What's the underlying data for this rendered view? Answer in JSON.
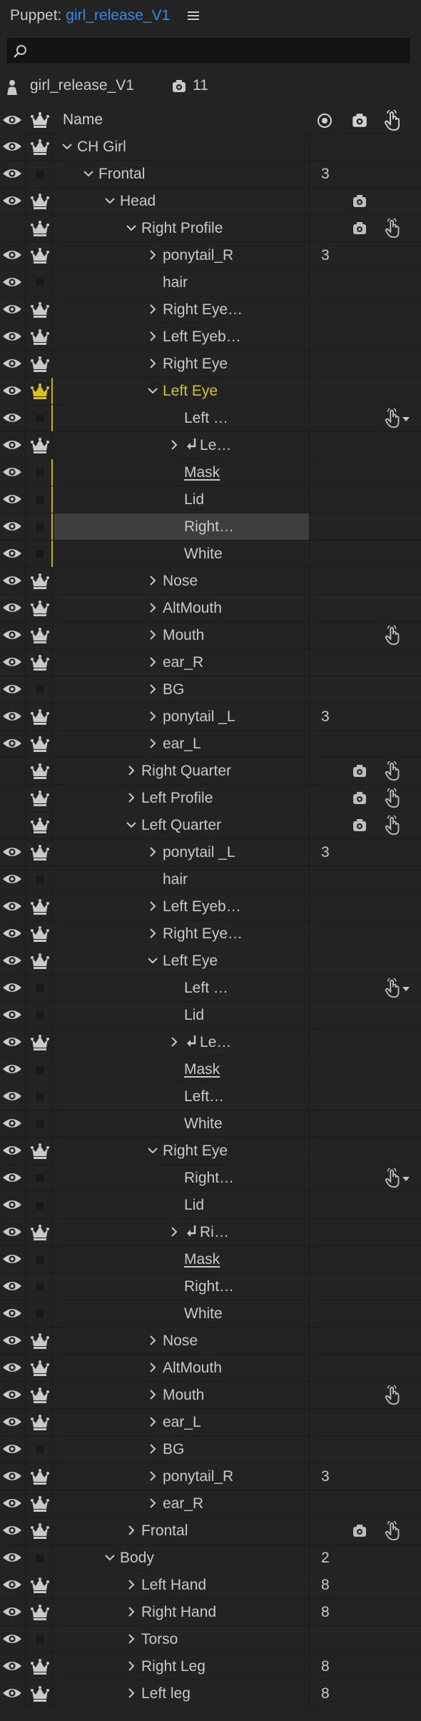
{
  "panel": {
    "title_prefix": "Puppet:",
    "doc_name": "girl_release_V1",
    "menu_icon": "hamburger-menu-icon",
    "search_icon": "search-icon",
    "puppet_name": "girl_release_V1",
    "camera_count": "11"
  },
  "columns": {
    "visibility_icon": "eye-icon",
    "independent_icon": "crown-icon",
    "name": "Name",
    "origin_icon": "origin-target-icon",
    "camera_icon": "camera-icon",
    "trigger_icon": "hand-trigger-icon"
  },
  "colors": {
    "accent": "#2d8ceb",
    "selected_layer": "#d7c224",
    "background": "#232323"
  },
  "rows": [
    {
      "name": "CH Girl",
      "depth": 0,
      "expand": "open",
      "eye": true,
      "crown": true,
      "col3": "",
      "cam": false,
      "trigger": ""
    },
    {
      "name": "Frontal",
      "depth": 1,
      "expand": "open",
      "eye": true,
      "crown": false,
      "col3": "3",
      "cam": false,
      "trigger": ""
    },
    {
      "name": "Head",
      "depth": 2,
      "expand": "open",
      "eye": true,
      "crown": true,
      "col3": "",
      "cam": true,
      "trigger": ""
    },
    {
      "name": "Right Profile",
      "depth": 3,
      "expand": "open",
      "eye": false,
      "crown": true,
      "col3": "",
      "cam": true,
      "trigger": "hand"
    },
    {
      "name": "ponytail_R",
      "depth": 4,
      "expand": "closed",
      "eye": true,
      "crown": true,
      "col3": "3",
      "cam": false,
      "trigger": ""
    },
    {
      "name": "hair",
      "depth": 4,
      "expand": "none",
      "eye": true,
      "crown": false,
      "col3": "",
      "cam": false,
      "trigger": ""
    },
    {
      "name": "Right Eye…",
      "depth": 4,
      "expand": "closed",
      "eye": true,
      "crown": true,
      "col3": "",
      "cam": false,
      "trigger": ""
    },
    {
      "name": "Left Eyeb…",
      "depth": 4,
      "expand": "closed",
      "eye": true,
      "crown": true,
      "col3": "",
      "cam": false,
      "trigger": ""
    },
    {
      "name": "Right Eye",
      "depth": 4,
      "expand": "closed",
      "eye": true,
      "crown": true,
      "col3": "",
      "cam": false,
      "trigger": ""
    },
    {
      "name": "Left Eye",
      "depth": 4,
      "expand": "open",
      "eye": true,
      "crown": true,
      "col3": "",
      "cam": false,
      "trigger": "",
      "selected": true
    },
    {
      "name": "Left …",
      "depth": 5,
      "expand": "none",
      "eye": true,
      "crown": false,
      "col3": "",
      "cam": false,
      "trigger": "hand-menu",
      "yellow": true
    },
    {
      "name": "Le…",
      "depth": 5,
      "expand": "closed",
      "arrow": true,
      "eye": true,
      "crown": true,
      "col3": "",
      "cam": false,
      "trigger": ""
    },
    {
      "name": "Mask",
      "depth": 5,
      "expand": "none",
      "underline": true,
      "eye": true,
      "crown": false,
      "col3": "",
      "cam": false,
      "trigger": "",
      "yellow": true
    },
    {
      "name": "Lid",
      "depth": 5,
      "expand": "none",
      "eye": true,
      "crown": false,
      "col3": "",
      "cam": false,
      "trigger": "",
      "yellow": true
    },
    {
      "name": "Right…",
      "depth": 5,
      "expand": "none",
      "eye": true,
      "crown": false,
      "col3": "",
      "cam": false,
      "trigger": "",
      "highlight": true,
      "yellow": true
    },
    {
      "name": "White",
      "depth": 5,
      "expand": "none",
      "eye": true,
      "crown": false,
      "col3": "",
      "cam": false,
      "trigger": "",
      "yellow": true
    },
    {
      "name": "Nose",
      "depth": 4,
      "expand": "closed",
      "eye": true,
      "crown": true,
      "col3": "",
      "cam": false,
      "trigger": ""
    },
    {
      "name": "AltMouth",
      "depth": 4,
      "expand": "closed",
      "eye": true,
      "crown": true,
      "col3": "",
      "cam": false,
      "trigger": ""
    },
    {
      "name": "Mouth",
      "depth": 4,
      "expand": "closed",
      "eye": true,
      "crown": true,
      "col3": "",
      "cam": false,
      "trigger": "hand"
    },
    {
      "name": "ear_R",
      "depth": 4,
      "expand": "closed",
      "eye": true,
      "crown": true,
      "col3": "",
      "cam": false,
      "trigger": ""
    },
    {
      "name": "BG",
      "depth": 4,
      "expand": "closed",
      "eye": true,
      "crown": false,
      "col3": "",
      "cam": false,
      "trigger": ""
    },
    {
      "name": "ponytail _L",
      "depth": 4,
      "expand": "closed",
      "eye": true,
      "crown": true,
      "col3": "3",
      "cam": false,
      "trigger": ""
    },
    {
      "name": "ear_L",
      "depth": 4,
      "expand": "closed",
      "eye": true,
      "crown": true,
      "col3": "",
      "cam": false,
      "trigger": ""
    },
    {
      "name": "Right Quarter",
      "depth": 3,
      "expand": "closed",
      "eye": false,
      "crown": true,
      "col3": "",
      "cam": true,
      "trigger": "hand"
    },
    {
      "name": "Left Profile",
      "depth": 3,
      "expand": "closed",
      "eye": false,
      "crown": true,
      "col3": "",
      "cam": true,
      "trigger": "hand"
    },
    {
      "name": "Left Quarter",
      "depth": 3,
      "expand": "open",
      "eye": false,
      "crown": true,
      "col3": "",
      "cam": true,
      "trigger": "hand"
    },
    {
      "name": "ponytail _L",
      "depth": 4,
      "expand": "closed",
      "eye": true,
      "crown": true,
      "col3": "3",
      "cam": false,
      "trigger": ""
    },
    {
      "name": "hair",
      "depth": 4,
      "expand": "none",
      "eye": true,
      "crown": false,
      "col3": "",
      "cam": false,
      "trigger": ""
    },
    {
      "name": "Left Eyeb…",
      "depth": 4,
      "expand": "closed",
      "eye": true,
      "crown": true,
      "col3": "",
      "cam": false,
      "trigger": ""
    },
    {
      "name": "Right Eye…",
      "depth": 4,
      "expand": "closed",
      "eye": true,
      "crown": true,
      "col3": "",
      "cam": false,
      "trigger": ""
    },
    {
      "name": "Left Eye",
      "depth": 4,
      "expand": "open",
      "eye": true,
      "crown": true,
      "col3": "",
      "cam": false,
      "trigger": ""
    },
    {
      "name": "Left …",
      "depth": 5,
      "expand": "none",
      "eye": true,
      "crown": false,
      "col3": "",
      "cam": false,
      "trigger": "hand-menu"
    },
    {
      "name": "Lid",
      "depth": 5,
      "expand": "none",
      "eye": true,
      "crown": false,
      "col3": "",
      "cam": false,
      "trigger": ""
    },
    {
      "name": "Le…",
      "depth": 5,
      "expand": "closed",
      "arrow": true,
      "eye": true,
      "crown": true,
      "col3": "",
      "cam": false,
      "trigger": ""
    },
    {
      "name": "Mask",
      "depth": 5,
      "expand": "none",
      "underline": true,
      "eye": true,
      "crown": false,
      "col3": "",
      "cam": false,
      "trigger": ""
    },
    {
      "name": "Left…",
      "depth": 5,
      "expand": "none",
      "eye": true,
      "crown": false,
      "col3": "",
      "cam": false,
      "trigger": ""
    },
    {
      "name": "White",
      "depth": 5,
      "expand": "none",
      "eye": true,
      "crown": false,
      "col3": "",
      "cam": false,
      "trigger": ""
    },
    {
      "name": "Right Eye",
      "depth": 4,
      "expand": "open",
      "eye": true,
      "crown": true,
      "col3": "",
      "cam": false,
      "trigger": ""
    },
    {
      "name": "Right…",
      "depth": 5,
      "expand": "none",
      "eye": true,
      "crown": false,
      "col3": "",
      "cam": false,
      "trigger": "hand-menu"
    },
    {
      "name": "Lid",
      "depth": 5,
      "expand": "none",
      "eye": true,
      "crown": false,
      "col3": "",
      "cam": false,
      "trigger": ""
    },
    {
      "name": "Ri…",
      "depth": 5,
      "expand": "closed",
      "arrow": true,
      "eye": true,
      "crown": true,
      "col3": "",
      "cam": false,
      "trigger": ""
    },
    {
      "name": "Mask",
      "depth": 5,
      "expand": "none",
      "underline": true,
      "eye": true,
      "crown": false,
      "col3": "",
      "cam": false,
      "trigger": ""
    },
    {
      "name": "Right…",
      "depth": 5,
      "expand": "none",
      "eye": true,
      "crown": false,
      "col3": "",
      "cam": false,
      "trigger": ""
    },
    {
      "name": "White",
      "depth": 5,
      "expand": "none",
      "eye": true,
      "crown": false,
      "col3": "",
      "cam": false,
      "trigger": ""
    },
    {
      "name": "Nose",
      "depth": 4,
      "expand": "closed",
      "eye": true,
      "crown": true,
      "col3": "",
      "cam": false,
      "trigger": ""
    },
    {
      "name": "AltMouth",
      "depth": 4,
      "expand": "closed",
      "eye": true,
      "crown": true,
      "col3": "",
      "cam": false,
      "trigger": ""
    },
    {
      "name": "Mouth",
      "depth": 4,
      "expand": "closed",
      "eye": true,
      "crown": true,
      "col3": "",
      "cam": false,
      "trigger": "hand"
    },
    {
      "name": "ear_L",
      "depth": 4,
      "expand": "closed",
      "eye": true,
      "crown": true,
      "col3": "",
      "cam": false,
      "trigger": ""
    },
    {
      "name": "BG",
      "depth": 4,
      "expand": "closed",
      "eye": true,
      "crown": false,
      "col3": "",
      "cam": false,
      "trigger": ""
    },
    {
      "name": "ponytail_R",
      "depth": 4,
      "expand": "closed",
      "eye": true,
      "crown": true,
      "col3": "3",
      "cam": false,
      "trigger": ""
    },
    {
      "name": "ear_R",
      "depth": 4,
      "expand": "closed",
      "eye": true,
      "crown": true,
      "col3": "",
      "cam": false,
      "trigger": ""
    },
    {
      "name": "Frontal",
      "depth": 3,
      "expand": "closed",
      "eye": true,
      "crown": true,
      "col3": "",
      "cam": true,
      "trigger": "hand"
    },
    {
      "name": "Body",
      "depth": 2,
      "expand": "open",
      "eye": true,
      "crown": false,
      "col3": "2",
      "cam": false,
      "trigger": ""
    },
    {
      "name": "Left Hand",
      "depth": 3,
      "expand": "closed",
      "eye": true,
      "crown": true,
      "col3": "8",
      "cam": false,
      "trigger": ""
    },
    {
      "name": "Right Hand",
      "depth": 3,
      "expand": "closed",
      "eye": true,
      "crown": true,
      "col3": "8",
      "cam": false,
      "trigger": ""
    },
    {
      "name": "Torso",
      "depth": 3,
      "expand": "closed",
      "eye": true,
      "crown": false,
      "col3": "",
      "cam": false,
      "trigger": ""
    },
    {
      "name": "Right Leg",
      "depth": 3,
      "expand": "closed",
      "eye": true,
      "crown": true,
      "col3": "8",
      "cam": false,
      "trigger": ""
    },
    {
      "name": "Left leg",
      "depth": 3,
      "expand": "closed",
      "eye": true,
      "crown": true,
      "col3": "8",
      "cam": false,
      "trigger": ""
    }
  ]
}
